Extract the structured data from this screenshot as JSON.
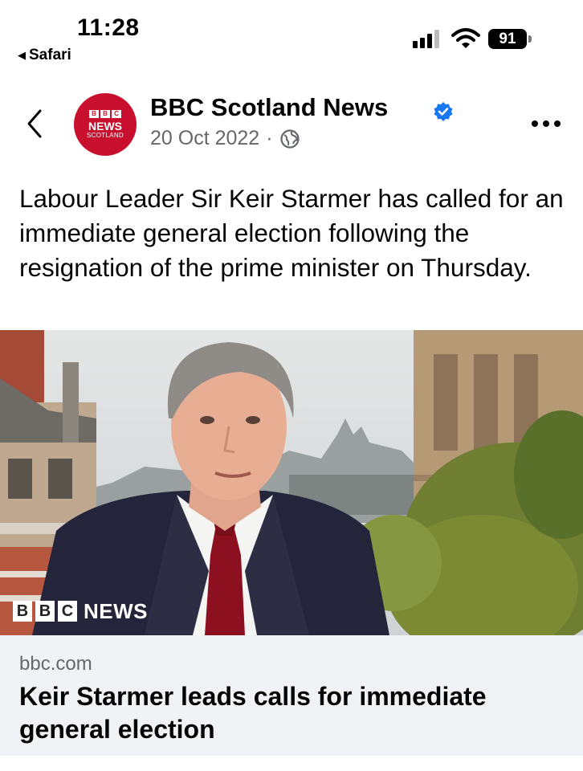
{
  "status_bar": {
    "time": "11:28",
    "back_app": "Safari",
    "battery": "91"
  },
  "post": {
    "page_name": "BBC Scotland News",
    "date": "20 Oct 2022",
    "separator": "·",
    "avatar_line1": "BBC",
    "avatar_line2": "NEWS",
    "avatar_line3": "SCOTLAND",
    "text": "Labour Leader Sir Keir Starmer has called for an immediate general election following the resignation of the prime minister on Thursday."
  },
  "link": {
    "watermark_b1": "B",
    "watermark_b2": "B",
    "watermark_b3": "C",
    "watermark_text": "NEWS",
    "domain": "bbc.com",
    "title": "Keir Starmer leads calls for immediate general election"
  },
  "icons": {
    "back": "chevron-left-icon",
    "verified": "verified-badge-icon",
    "audience": "globe-icon",
    "more": "more-options-icon"
  },
  "colors": {
    "bbc_red": "#c8102e",
    "verified_blue": "#1877f2",
    "secondary_text": "#65676b",
    "link_footer_bg": "#f0f2f5"
  }
}
